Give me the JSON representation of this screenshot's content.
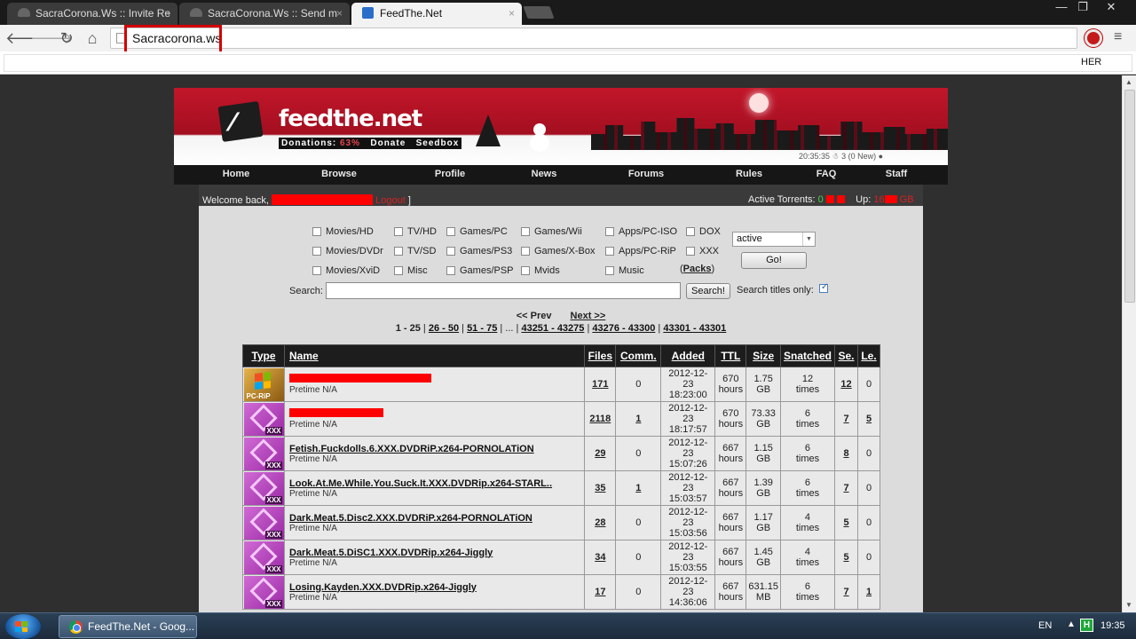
{
  "browser": {
    "tabs": [
      {
        "title": "SacraCorona.Ws :: Invite Re"
      },
      {
        "title": "SacraCorona.Ws :: Send m"
      },
      {
        "title": "FeedThe.Net"
      }
    ],
    "tab_close": "×",
    "window_buttons": {
      "minimize": "—",
      "maximize": "❐",
      "close": "✕"
    },
    "url": "Sacracorona.ws",
    "bookmark_label": "HER",
    "nav": {
      "back": "🡐",
      "forward": "🡒",
      "reload": "↻",
      "home": "⌂",
      "menu": "≡"
    }
  },
  "site": {
    "banner": {
      "title": "feedthe.net",
      "logo_mark": "⁄",
      "donations_label": "Donations:",
      "donations_pct": "63%",
      "donate": "Donate",
      "seedbox": "Seedbox",
      "clock": "20:35:35 ☃ 3 (0 New) ●"
    },
    "nav": [
      "Home",
      "Browse",
      "Profile",
      "News",
      "Forums",
      "Rules",
      "FAQ",
      "Staff"
    ],
    "welcome_prefix": "Welcome back,",
    "logout": "Logout",
    "bracket_close": "]",
    "active_torrents_label": "Active Torrents:",
    "active_torrents_val": "0",
    "up_label": "Up:",
    "up_value": "16",
    "up_unit": "GB",
    "categories": [
      {
        "label": "Movies/HD"
      },
      {
        "label": "TV/HD"
      },
      {
        "label": "Games/PC"
      },
      {
        "label": "Games/Wii"
      },
      {
        "label": "Apps/PC-ISO"
      },
      {
        "label": "DOX"
      },
      {
        "label": "Movies/DVDr"
      },
      {
        "label": "TV/SD"
      },
      {
        "label": "Games/PS3"
      },
      {
        "label": "Games/X-Box"
      },
      {
        "label": "Apps/PC-RiP"
      },
      {
        "label": "XXX"
      },
      {
        "label": "Movies/XviD"
      },
      {
        "label": "Misc"
      },
      {
        "label": "Games/PSP"
      },
      {
        "label": "Mvids"
      },
      {
        "label": "Music"
      }
    ],
    "packs_open": "(",
    "packs": "Packs",
    "packs_close": ")",
    "status_select": "active",
    "go_button": "Go!",
    "search_label": "Search:",
    "search_value": "",
    "search_button": "Search!",
    "titles_only_label": "Search titles only:",
    "pager": {
      "prev": "<< Prev",
      "next": "Next >>",
      "current": "1 - 25",
      "pages": [
        "26 - 50",
        "51 - 75",
        "43251 - 43275",
        "43276 - 43300",
        "43301 - 43301"
      ],
      "ellipsis": "..."
    },
    "table": {
      "headers": [
        "Type",
        "Name",
        "Files",
        "Comm.",
        "Added",
        "TTL",
        "Size",
        "Snatched",
        "Se.",
        "Le."
      ],
      "rows": [
        {
          "type": "pc",
          "type_label": "PC-RiP",
          "name": "",
          "redact_w": 160,
          "pretime": "Pretime N/A",
          "files": "171",
          "comm": "0",
          "date": "2012-12-23",
          "time": "18:23:00",
          "ttl": "670",
          "ttl_unit": "hours",
          "size": "1.75",
          "size_unit": "GB",
          "snatched": "12",
          "snatched_unit": "times",
          "se": "12",
          "le": "0"
        },
        {
          "type": "xxx",
          "type_label": "XXX",
          "name": "",
          "redact_w": 106,
          "pretime": "Pretime N/A",
          "files": "2118",
          "comm": "1",
          "date": "2012-12-23",
          "time": "18:17:57",
          "ttl": "670",
          "ttl_unit": "hours",
          "size": "73.33",
          "size_unit": "GB",
          "snatched": "6",
          "snatched_unit": "times",
          "se": "7",
          "le": "5"
        },
        {
          "type": "xxx",
          "type_label": "XXX",
          "name": "Fetish.Fuckdolls.6.XXX.DVDRiP.x264-PORNOLATiON",
          "pretime": "Pretime N/A",
          "files": "29",
          "comm": "0",
          "date": "2012-12-23",
          "time": "15:07:26",
          "ttl": "667",
          "ttl_unit": "hours",
          "size": "1.15",
          "size_unit": "GB",
          "snatched": "6",
          "snatched_unit": "times",
          "se": "8",
          "le": "0"
        },
        {
          "type": "xxx",
          "type_label": "XXX",
          "name": "Look.At.Me.While.You.Suck.It.XXX.DVDRip.x264-STARL..",
          "pretime": "Pretime N/A",
          "files": "35",
          "comm": "1",
          "date": "2012-12-23",
          "time": "15:03:57",
          "ttl": "667",
          "ttl_unit": "hours",
          "size": "1.39",
          "size_unit": "GB",
          "snatched": "6",
          "snatched_unit": "times",
          "se": "7",
          "le": "0"
        },
        {
          "type": "xxx",
          "type_label": "XXX",
          "name": "Dark.Meat.5.Disc2.XXX.DVDRiP.x264-PORNOLATiON",
          "pretime": "Pretime N/A",
          "files": "28",
          "comm": "0",
          "date": "2012-12-23",
          "time": "15:03:56",
          "ttl": "667",
          "ttl_unit": "hours",
          "size": "1.17",
          "size_unit": "GB",
          "snatched": "4",
          "snatched_unit": "times",
          "se": "5",
          "le": "0"
        },
        {
          "type": "xxx",
          "type_label": "XXX",
          "name": "Dark.Meat.5.DiSC1.XXX.DVDRip.x264-Jiggly",
          "pretime": "Pretime N/A",
          "files": "34",
          "comm": "0",
          "date": "2012-12-23",
          "time": "15:03:55",
          "ttl": "667",
          "ttl_unit": "hours",
          "size": "1.45",
          "size_unit": "GB",
          "snatched": "4",
          "snatched_unit": "times",
          "se": "5",
          "le": "0"
        },
        {
          "type": "xxx",
          "type_label": "XXX",
          "name": "Losing.Kayden.XXX.DVDRip.x264-Jiggly",
          "pretime": "Pretime N/A",
          "files": "17",
          "comm": "0",
          "date": "2012-12-23",
          "time": "14:36:06",
          "ttl": "667",
          "ttl_unit": "hours",
          "size": "631.15",
          "size_unit": "MB",
          "snatched": "6",
          "snatched_unit": "times",
          "se": "7",
          "le": "1"
        }
      ]
    }
  },
  "taskbar": {
    "task_title": "FeedThe.Net - Goog...",
    "lang": "EN",
    "tray_arrow": "▲",
    "tray_icon_letter": "H",
    "clock": "19:35"
  }
}
